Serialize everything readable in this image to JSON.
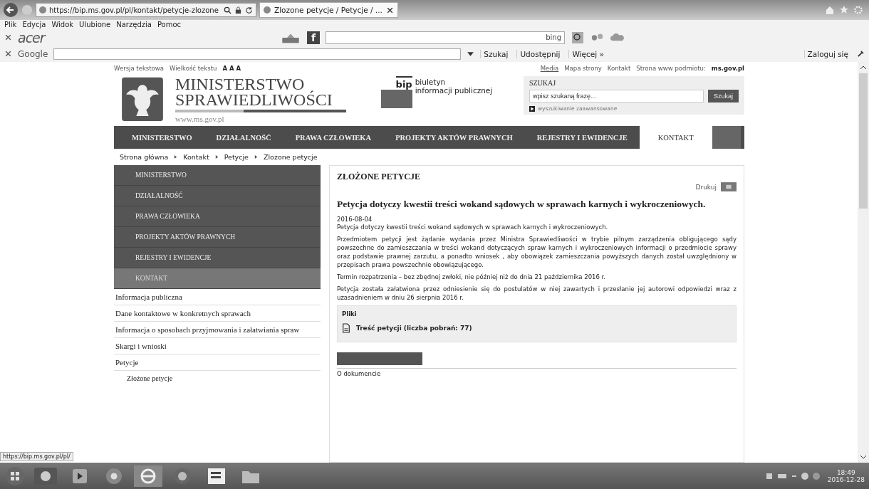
{
  "browser": {
    "address": "https://bip.ms.gov.pl/pl/kontakt/petycje-zlozone",
    "tab_title": "Zlozone petycje / Petycje / ...",
    "menu": [
      "Plik",
      "Edycja",
      "Widok",
      "Ulubione",
      "Narzędzia",
      "Pomoc"
    ],
    "acer_toolbar": {
      "logo": "acer",
      "facebook": "f",
      "bing": "bing"
    },
    "google_toolbar": {
      "logo": "Google",
      "search": "Szukaj",
      "share": "Udostępnij",
      "more": "Więcej »",
      "login": "Zaloguj się"
    },
    "status_url": "https://bip.ms.gov.pl/pl/"
  },
  "top_links": {
    "left": [
      "Wersja tekstowa",
      "Wielkość tekstu"
    ],
    "text_sizes": "A A A",
    "right": [
      "Media",
      "Mapa strony",
      "Kontakt"
    ],
    "site_label": "Strona www podmiotu:",
    "site": "ms.gov.pl"
  },
  "header": {
    "title_line1": "MINISTERSTWO",
    "title_line2": "SPRAWIEDLIWOŚCI",
    "url": "www.ms.gov.pl",
    "bip_logo": "bip",
    "bip_line1": "biuletyn",
    "bip_line2": "informacji publicznej",
    "search": {
      "heading": "SZUKAJ",
      "placeholder": "wpisz szukaną frazę...",
      "button": "Szukaj",
      "advanced": "wyszukiwanie zaawansowane"
    }
  },
  "nav": [
    {
      "label": "MINISTERSTWO",
      "selected": false
    },
    {
      "label": "DZIAŁALNOŚĆ",
      "selected": false
    },
    {
      "label": "PRAWA CZŁOWIEKA",
      "selected": false
    },
    {
      "label": "PROJEKTY AKTÓW PRAWNYCH",
      "selected": false
    },
    {
      "label": "REJESTRY I EWIDENCJE",
      "selected": false
    },
    {
      "label": "KONTAKT",
      "selected": true
    }
  ],
  "breadcrumb": [
    "Strona główna",
    "Kontakt",
    "Petycje",
    "Zlozone petycje"
  ],
  "sidebar": {
    "sections": [
      {
        "label": "MINISTERSTWO",
        "selected": false
      },
      {
        "label": "DZIAŁALNOŚĆ",
        "selected": false
      },
      {
        "label": "PRAWA CZŁOWIEKA",
        "selected": false
      },
      {
        "label": "PROJEKTY AKTÓW PRAWNYCH",
        "selected": false
      },
      {
        "label": "REJESTRY I EWIDENCJE",
        "selected": false
      },
      {
        "label": "KONTAKT",
        "selected": true
      }
    ],
    "items": [
      {
        "label": "Informacja publiczna"
      },
      {
        "label": "Dane kontaktowe w konkretnych sprawach"
      },
      {
        "label": "Informacja o sposobach przyjmowania i załatwiania spraw"
      },
      {
        "label": "Skargi i wnioski"
      },
      {
        "label": "Petycje",
        "children": [
          {
            "label": "Złożone petycje"
          }
        ]
      }
    ]
  },
  "content": {
    "heading": "ZŁOŻONE PETYCJE",
    "print": "Drukuj",
    "title": "Petycja dotyczy kwestii treści wokand sądowych w sprawach karnych i wykroczeniowych.",
    "date": "2016-08-04",
    "paragraphs": [
      "Petycja dotyczy kwestii treści wokand sądowych w sprawach karnych i wykroczeniowych.",
      "Przedmiotem petycji jest żądanie wydania przez Ministra Sprawiedliwości w trybie pilnym zarządzenia obligującego sądy powszechne do zamieszczania w treści wokand dotyczących spraw karnych i wykroczeniowych informacji o przedmiocie sprawy oraz podstawie prawnej zarzutu, a ponadto wniosek , aby obowiązek zamieszczania powyższych danych został uwzględniony w przepisach prawa powszechnie obowiązującego.",
      "Termin rozpatrzenia – bez zbędnej zwłoki, nie później niż do dnia 21 października 2016 r.",
      "Petycja została załatwiona przez odniesienie się do postulatów w niej zawartych i przesłanie jej autorowi odpowiedzi wraz z uzasadnieniem w dniu 26 sierpnia 2016 r."
    ],
    "files_heading": "Pliki",
    "files": [
      {
        "label": "Treść petycji (liczba pobrań: 77)"
      }
    ],
    "about": "O dokumencie"
  },
  "taskbar": {
    "time": "18:49",
    "date": "2016-12-28"
  }
}
